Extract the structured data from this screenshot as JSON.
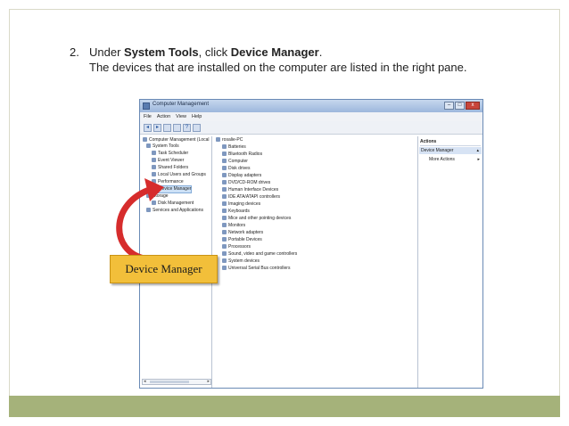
{
  "slide": {
    "step_number": "2.",
    "line1_prefix": "Under ",
    "line1_bold1": "System Tools",
    "line1_middle": ", click ",
    "line1_bold2": "Device Manager",
    "line1_suffix": ".",
    "line2": "The devices that are installed on the computer are listed in the right pane."
  },
  "window": {
    "title": "Computer Management",
    "menu": [
      "File",
      "Action",
      "View",
      "Help"
    ],
    "controls": {
      "minimize": "–",
      "maximize": "□",
      "close": "x"
    },
    "toolbar_icons": [
      "back-arrow-icon",
      "forward-arrow-icon",
      "folder-icon",
      "properties-icon",
      "help-icon",
      "view-icon"
    ]
  },
  "tree": [
    {
      "label": "Computer Management (Local",
      "indent": 0,
      "icon": "computer-icon"
    },
    {
      "label": "System Tools",
      "indent": 1,
      "icon": "tools-icon"
    },
    {
      "label": "Task Scheduler",
      "indent": 2,
      "icon": "clock-icon"
    },
    {
      "label": "Event Viewer",
      "indent": 2,
      "icon": "event-icon"
    },
    {
      "label": "Shared Folders",
      "indent": 2,
      "icon": "folder-icon"
    },
    {
      "label": "Local Users and Groups",
      "indent": 2,
      "icon": "users-icon"
    },
    {
      "label": "Performance",
      "indent": 2,
      "icon": "performance-icon"
    },
    {
      "label": "Device Manager",
      "indent": 2,
      "icon": "device-manager-icon",
      "selected": true
    },
    {
      "label": "Storage",
      "indent": 1,
      "icon": "storage-icon"
    },
    {
      "label": "Disk Management",
      "indent": 2,
      "icon": "disk-icon"
    },
    {
      "label": "Services and Applications",
      "indent": 1,
      "icon": "services-icon"
    }
  ],
  "devices": {
    "root": "rosalie-PC",
    "items": [
      "Batteries",
      "Bluetooth Radios",
      "Computer",
      "Disk drives",
      "Display adapters",
      "DVD/CD-ROM drives",
      "Human Interface Devices",
      "IDE ATA/ATAPI controllers",
      "Imaging devices",
      "Keyboards",
      "Mice and other pointing devices",
      "Monitors",
      "Network adapters",
      "Portable Devices",
      "Processors",
      "Sound, video and game controllers",
      "System devices",
      "Universal Serial Bus controllers"
    ]
  },
  "actions": {
    "header": "Actions",
    "section": "Device Manager",
    "more": "More Actions"
  },
  "callout": {
    "label": "Device Manager"
  },
  "colors": {
    "callout_fill": "#f2bf3a",
    "arrow": "#d62c2c",
    "footer_bar": "#a5b27a",
    "selection": "#cde1f6"
  }
}
